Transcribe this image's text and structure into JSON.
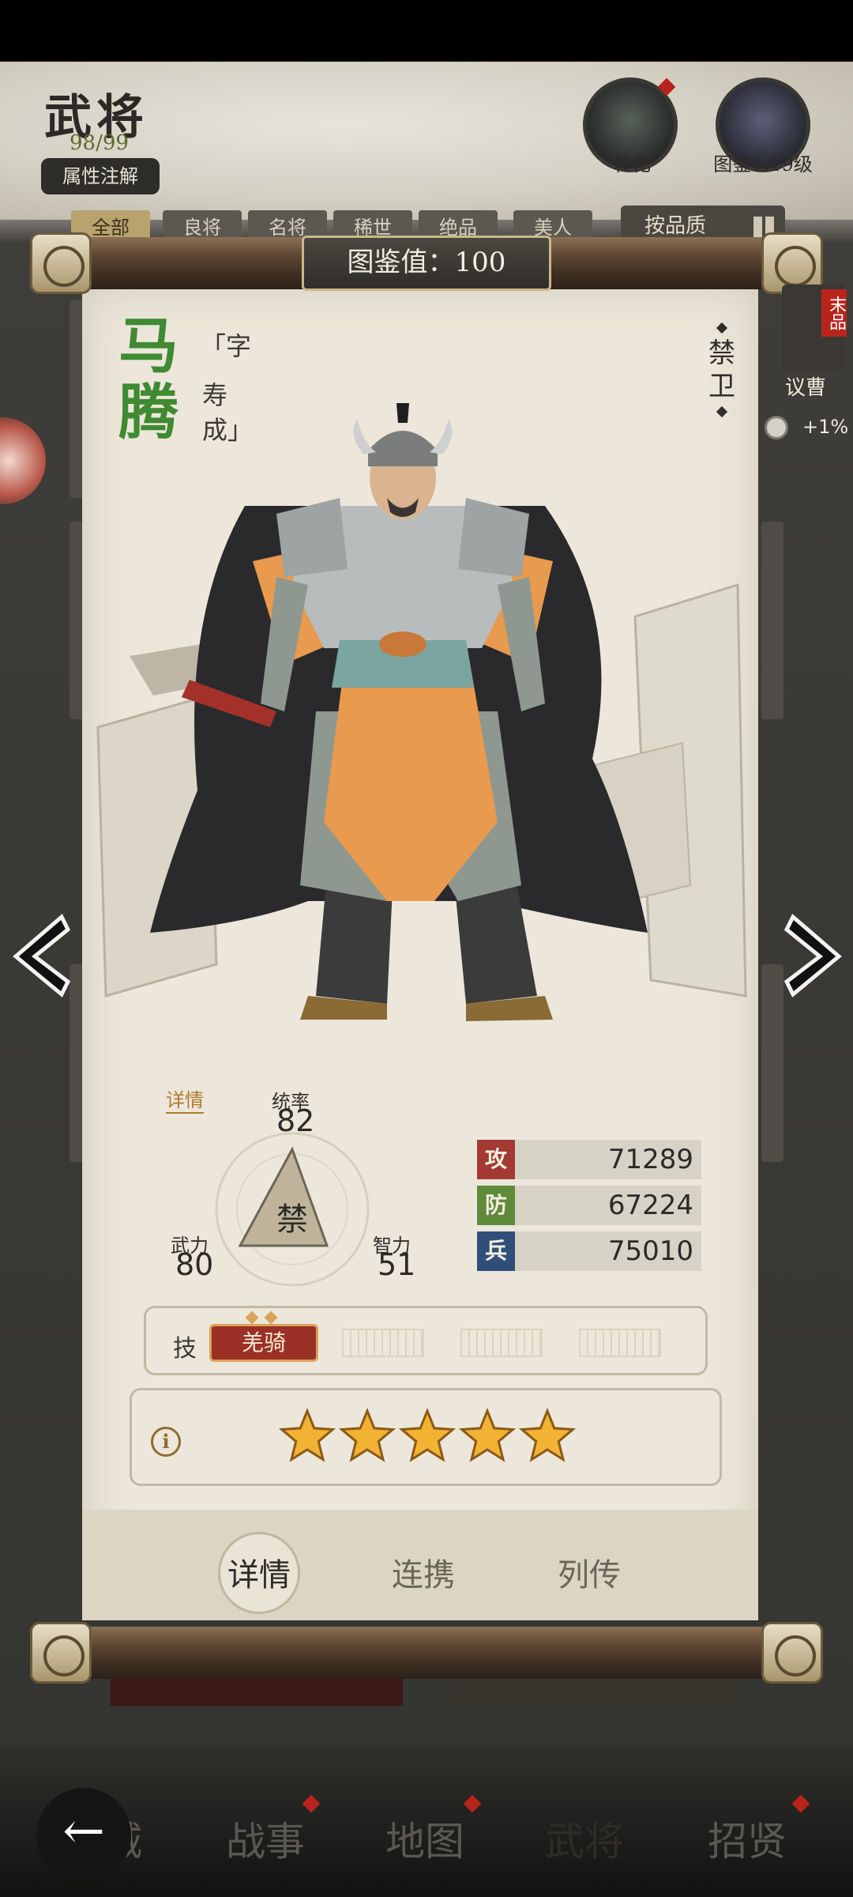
{
  "header": {
    "title": "武将",
    "count": "98/99",
    "attr_note": "属性注解",
    "transform_label": "转化",
    "codex_label": "图鉴1.19级"
  },
  "filters": [
    "全部",
    "良将",
    "名将",
    "稀世",
    "绝品",
    "美人"
  ],
  "sort_label": "按品质",
  "codex_value": "图鉴值：100",
  "side_panel": {
    "badge": "末品",
    "hero_name": "议曹",
    "bonus": "+1%"
  },
  "hero": {
    "name": "马腾",
    "courtesy_prefix": "「字",
    "courtesy_name": "寿成」",
    "title": "禁卫",
    "detail_link": "详情",
    "troop_type": "禁",
    "leadership_label": "统率",
    "leadership": "82",
    "force_label": "武力",
    "force": "80",
    "intellect_label": "智力",
    "intellect": "51"
  },
  "stats": [
    {
      "icon": "攻",
      "value": "71289",
      "color": "#a23a33"
    },
    {
      "icon": "防",
      "value": "67224",
      "color": "#5f8a3a"
    },
    {
      "icon": "兵",
      "value": "75010",
      "color": "#2f4f79"
    }
  ],
  "skills": {
    "label": "技",
    "skill1": "羌骑"
  },
  "stars": 5,
  "tabs": {
    "details": "详情",
    "synergy": "连携",
    "biography": "列传"
  },
  "nav": {
    "item1": "城",
    "item2": "战事",
    "item3": "地图",
    "item4": "武将",
    "item5": "招贤"
  }
}
